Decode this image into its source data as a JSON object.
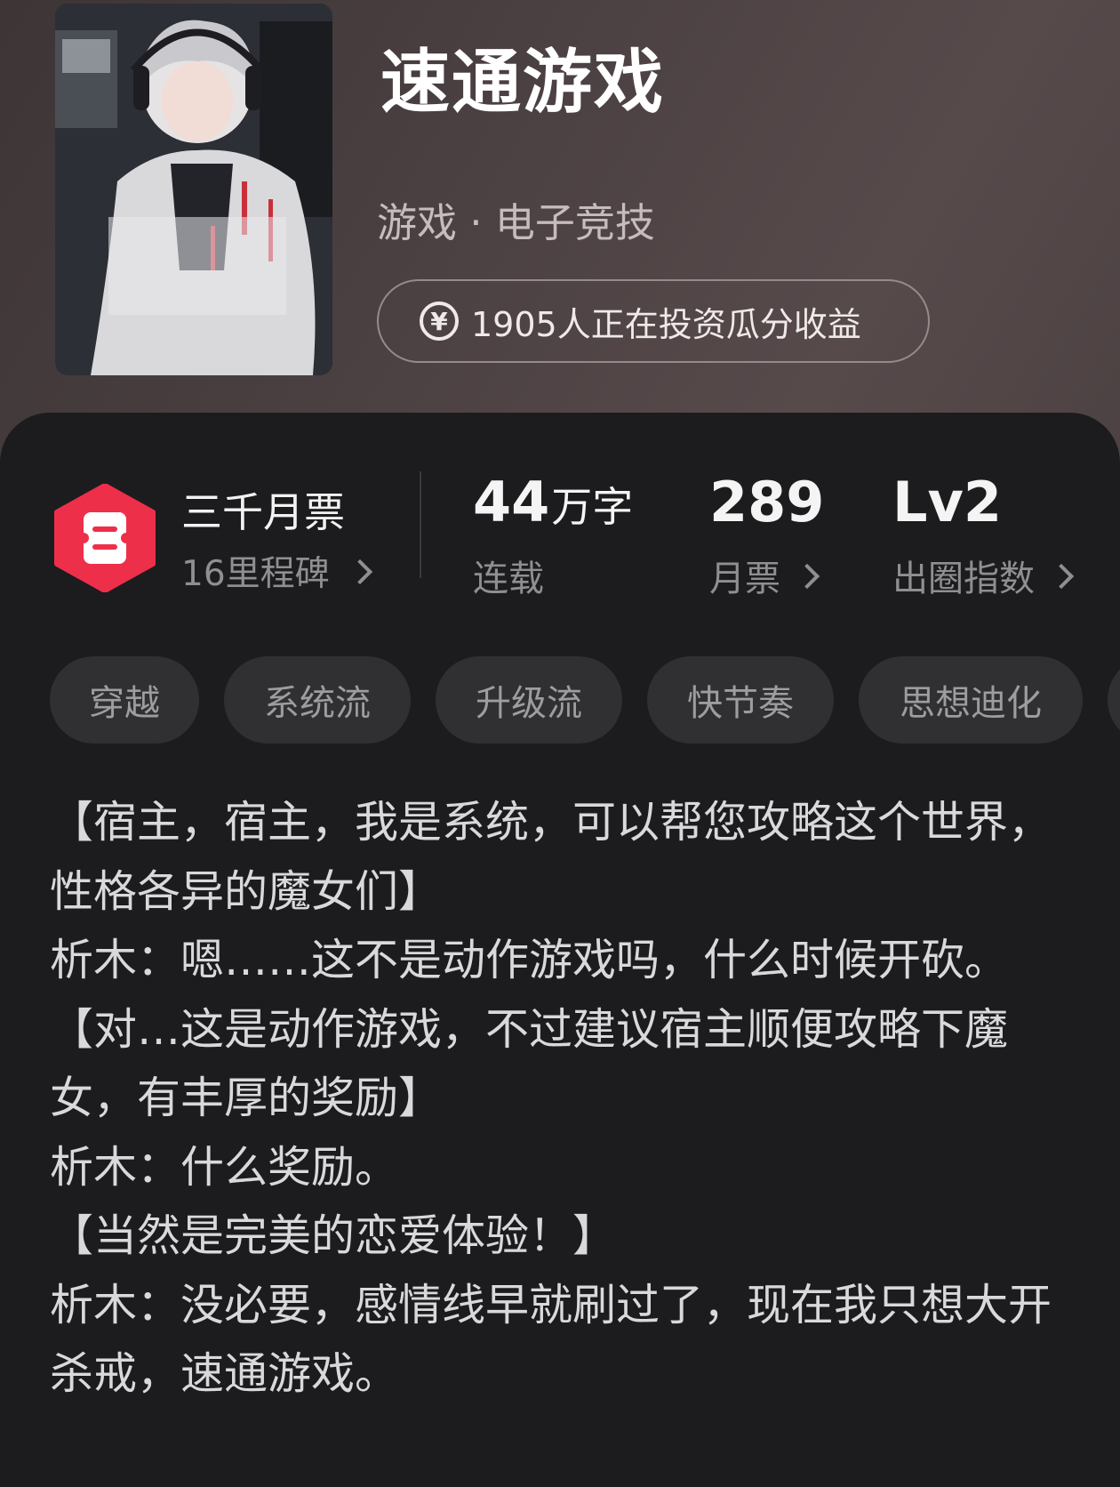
{
  "book": {
    "title": "速通游戏",
    "genre": "游戏 · 电子竞技",
    "invest_text": "1905人正在投资瓜分收益",
    "cover_alt": "book-cover"
  },
  "stats": {
    "badge_title": "三千月票",
    "badge_sub": "16里程碑",
    "words_value": "44",
    "words_unit": "万字",
    "words_label": "连载",
    "tickets_value": "289",
    "tickets_label": "月票",
    "index_value": "Lv2",
    "index_label": "出圈指数"
  },
  "tags": [
    "穿越",
    "系统流",
    "升级流",
    "快节奏",
    "思想迪化"
  ],
  "synopsis": [
    "【宿主，宿主，我是系统，可以帮您攻略这个世界，性格各异的魔女们】",
    "析木：嗯……这不是动作游戏吗，什么时候开砍。",
    "【对…这是动作游戏，不过建议宿主顺便攻略下魔女，有丰厚的奖励】",
    "析木：什么奖励。",
    "【当然是完美的恋爱体验！】",
    "析木：没必要，感情线早就刷过了，现在我只想大开杀戒，速通游戏。"
  ],
  "colors": {
    "badge_red": "#ee2f4a",
    "panel_bg": "#1c1c1e",
    "tag_bg": "#303032"
  }
}
